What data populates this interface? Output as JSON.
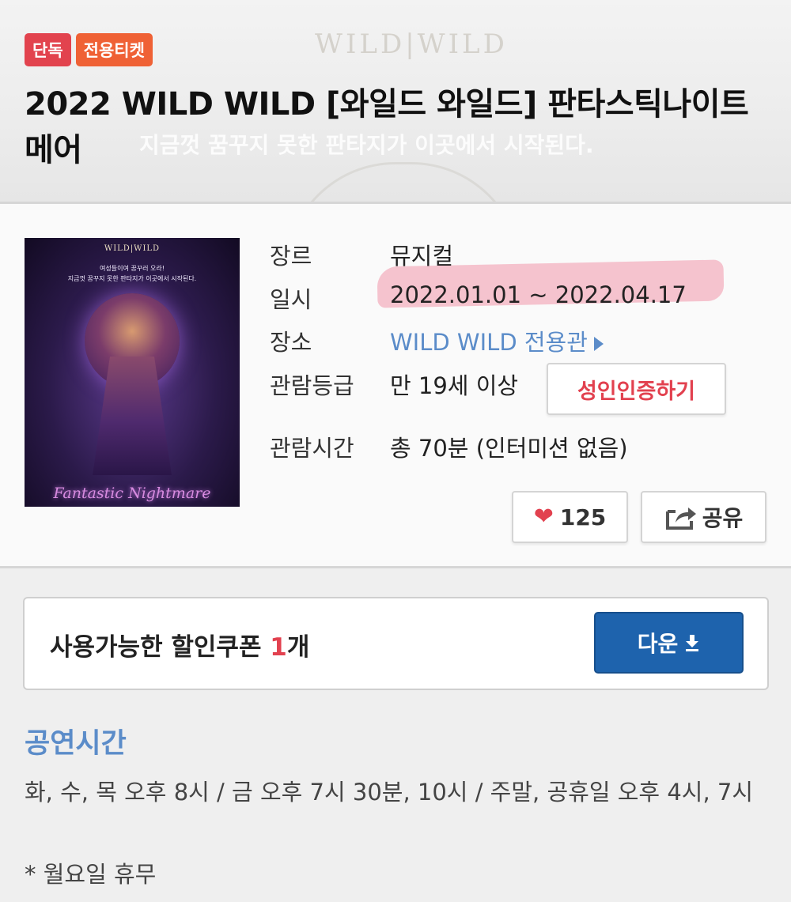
{
  "header": {
    "bg_logo": "WILD|WILD",
    "bg_text": "지금껏 꿈꾸지 못한 판타지가 이곳에서 시작된다.",
    "badges": [
      "단독",
      "전용티켓"
    ],
    "title": "2022 WILD WILD [와일드 와일드] 판타스틱나이트메어"
  },
  "poster": {
    "logo": "WILD|WILD",
    "tagline_1": "여성들이여 꿈꾸러 오라!",
    "tagline_2": "지금껏 꿈꾸지 못한 판타지가 이곳에서 시작된다.",
    "script_title": "Fantastic Nightmare"
  },
  "info": {
    "genre_label": "장르",
    "genre_value": "뮤지컬",
    "date_label": "일시",
    "date_value": "2022.01.01 ~ 2022.04.17",
    "venue_label": "장소",
    "venue_value": "WILD WILD 전용관",
    "rating_label": "관람등급",
    "rating_value": "만 19세 이상",
    "adult_verify_label": "성인인증하기",
    "runtime_label": "관람시간",
    "runtime_value": "총 70분 (인터미션 없음)"
  },
  "actions": {
    "like_count": "125",
    "share_label": "공유"
  },
  "coupon": {
    "text_prefix": "사용가능한 할인쿠폰 ",
    "count": "1",
    "text_suffix": "개",
    "download_label": "다운"
  },
  "showtime": {
    "title": "공연시간",
    "schedule": "화, 수, 목 오후 8시 / 금 오후 7시 30분, 10시 / 주말, 공휴일 오후 4시, 7시",
    "closed_note": "* 월요일 휴무"
  },
  "colors": {
    "badge_exclusive": "#e2434e",
    "badge_ticket": "#ef6135",
    "link_blue": "#5b8cc9",
    "accent_red": "#e2414f",
    "download_blue": "#1e63ad",
    "highlight_pink": "#f096aa"
  }
}
